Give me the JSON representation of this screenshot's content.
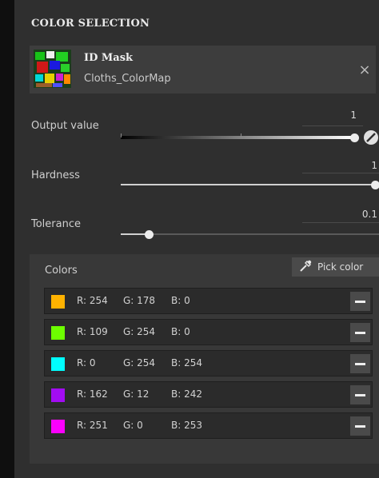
{
  "header": {
    "title": "COLOR SELECTION"
  },
  "mask": {
    "title": "ID Mask",
    "subtitle": "Cloths_ColorMap",
    "close_glyph": "×"
  },
  "sliders": {
    "output": {
      "label": "Output value",
      "value": "1",
      "fraction": 1.0
    },
    "hardness": {
      "label": "Hardness",
      "value": "1",
      "fraction": 1.0
    },
    "tolerance": {
      "label": "Tolerance",
      "value": "0.1",
      "fraction": 0.1
    }
  },
  "colors": {
    "label": "Colors",
    "pick_label": "Pick color",
    "items": [
      {
        "r": "R: 254",
        "g": "G: 178",
        "b": "B: 0",
        "hex": "#feb200"
      },
      {
        "r": "R: 109",
        "g": "G: 254",
        "b": "B: 0",
        "hex": "#6dfe00"
      },
      {
        "r": "R: 0",
        "g": "G: 254",
        "b": "B: 254",
        "hex": "#00fefe"
      },
      {
        "r": "R: 162",
        "g": "G: 12",
        "b": "B: 242",
        "hex": "#a20cf2"
      },
      {
        "r": "R: 251",
        "g": "G: 0",
        "b": "B: 253",
        "hex": "#fb00fd"
      }
    ]
  },
  "icons": {
    "close": "close-icon",
    "edit": "edit-icon",
    "eyedropper": "eyedropper-icon",
    "remove": "minus-icon"
  }
}
